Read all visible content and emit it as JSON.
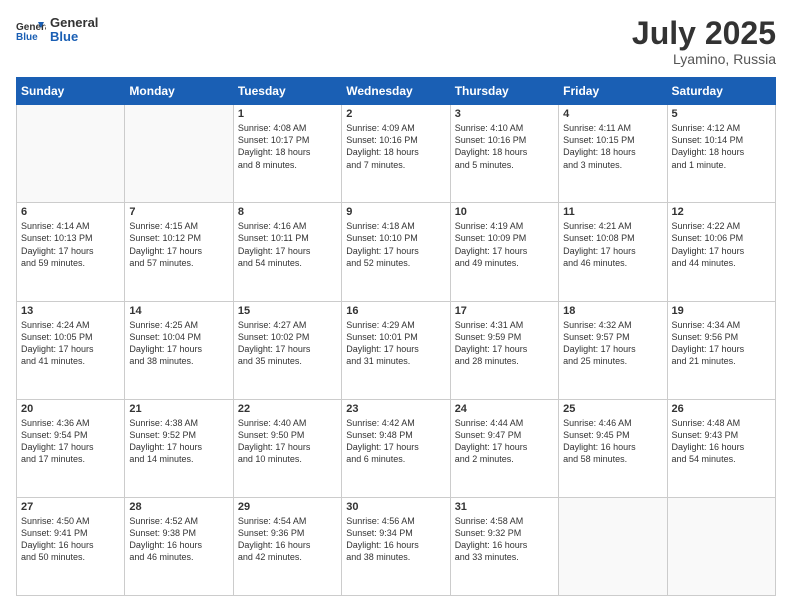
{
  "logo": {
    "text_general": "General",
    "text_blue": "Blue"
  },
  "title": "July 2025",
  "location": "Lyamino, Russia",
  "days_of_week": [
    "Sunday",
    "Monday",
    "Tuesday",
    "Wednesday",
    "Thursday",
    "Friday",
    "Saturday"
  ],
  "weeks": [
    [
      {
        "day": "",
        "info": ""
      },
      {
        "day": "",
        "info": ""
      },
      {
        "day": "1",
        "info": "Sunrise: 4:08 AM\nSunset: 10:17 PM\nDaylight: 18 hours\nand 8 minutes."
      },
      {
        "day": "2",
        "info": "Sunrise: 4:09 AM\nSunset: 10:16 PM\nDaylight: 18 hours\nand 7 minutes."
      },
      {
        "day": "3",
        "info": "Sunrise: 4:10 AM\nSunset: 10:16 PM\nDaylight: 18 hours\nand 5 minutes."
      },
      {
        "day": "4",
        "info": "Sunrise: 4:11 AM\nSunset: 10:15 PM\nDaylight: 18 hours\nand 3 minutes."
      },
      {
        "day": "5",
        "info": "Sunrise: 4:12 AM\nSunset: 10:14 PM\nDaylight: 18 hours\nand 1 minute."
      }
    ],
    [
      {
        "day": "6",
        "info": "Sunrise: 4:14 AM\nSunset: 10:13 PM\nDaylight: 17 hours\nand 59 minutes."
      },
      {
        "day": "7",
        "info": "Sunrise: 4:15 AM\nSunset: 10:12 PM\nDaylight: 17 hours\nand 57 minutes."
      },
      {
        "day": "8",
        "info": "Sunrise: 4:16 AM\nSunset: 10:11 PM\nDaylight: 17 hours\nand 54 minutes."
      },
      {
        "day": "9",
        "info": "Sunrise: 4:18 AM\nSunset: 10:10 PM\nDaylight: 17 hours\nand 52 minutes."
      },
      {
        "day": "10",
        "info": "Sunrise: 4:19 AM\nSunset: 10:09 PM\nDaylight: 17 hours\nand 49 minutes."
      },
      {
        "day": "11",
        "info": "Sunrise: 4:21 AM\nSunset: 10:08 PM\nDaylight: 17 hours\nand 46 minutes."
      },
      {
        "day": "12",
        "info": "Sunrise: 4:22 AM\nSunset: 10:06 PM\nDaylight: 17 hours\nand 44 minutes."
      }
    ],
    [
      {
        "day": "13",
        "info": "Sunrise: 4:24 AM\nSunset: 10:05 PM\nDaylight: 17 hours\nand 41 minutes."
      },
      {
        "day": "14",
        "info": "Sunrise: 4:25 AM\nSunset: 10:04 PM\nDaylight: 17 hours\nand 38 minutes."
      },
      {
        "day": "15",
        "info": "Sunrise: 4:27 AM\nSunset: 10:02 PM\nDaylight: 17 hours\nand 35 minutes."
      },
      {
        "day": "16",
        "info": "Sunrise: 4:29 AM\nSunset: 10:01 PM\nDaylight: 17 hours\nand 31 minutes."
      },
      {
        "day": "17",
        "info": "Sunrise: 4:31 AM\nSunset: 9:59 PM\nDaylight: 17 hours\nand 28 minutes."
      },
      {
        "day": "18",
        "info": "Sunrise: 4:32 AM\nSunset: 9:57 PM\nDaylight: 17 hours\nand 25 minutes."
      },
      {
        "day": "19",
        "info": "Sunrise: 4:34 AM\nSunset: 9:56 PM\nDaylight: 17 hours\nand 21 minutes."
      }
    ],
    [
      {
        "day": "20",
        "info": "Sunrise: 4:36 AM\nSunset: 9:54 PM\nDaylight: 17 hours\nand 17 minutes."
      },
      {
        "day": "21",
        "info": "Sunrise: 4:38 AM\nSunset: 9:52 PM\nDaylight: 17 hours\nand 14 minutes."
      },
      {
        "day": "22",
        "info": "Sunrise: 4:40 AM\nSunset: 9:50 PM\nDaylight: 17 hours\nand 10 minutes."
      },
      {
        "day": "23",
        "info": "Sunrise: 4:42 AM\nSunset: 9:48 PM\nDaylight: 17 hours\nand 6 minutes."
      },
      {
        "day": "24",
        "info": "Sunrise: 4:44 AM\nSunset: 9:47 PM\nDaylight: 17 hours\nand 2 minutes."
      },
      {
        "day": "25",
        "info": "Sunrise: 4:46 AM\nSunset: 9:45 PM\nDaylight: 16 hours\nand 58 minutes."
      },
      {
        "day": "26",
        "info": "Sunrise: 4:48 AM\nSunset: 9:43 PM\nDaylight: 16 hours\nand 54 minutes."
      }
    ],
    [
      {
        "day": "27",
        "info": "Sunrise: 4:50 AM\nSunset: 9:41 PM\nDaylight: 16 hours\nand 50 minutes."
      },
      {
        "day": "28",
        "info": "Sunrise: 4:52 AM\nSunset: 9:38 PM\nDaylight: 16 hours\nand 46 minutes."
      },
      {
        "day": "29",
        "info": "Sunrise: 4:54 AM\nSunset: 9:36 PM\nDaylight: 16 hours\nand 42 minutes."
      },
      {
        "day": "30",
        "info": "Sunrise: 4:56 AM\nSunset: 9:34 PM\nDaylight: 16 hours\nand 38 minutes."
      },
      {
        "day": "31",
        "info": "Sunrise: 4:58 AM\nSunset: 9:32 PM\nDaylight: 16 hours\nand 33 minutes."
      },
      {
        "day": "",
        "info": ""
      },
      {
        "day": "",
        "info": ""
      }
    ]
  ]
}
